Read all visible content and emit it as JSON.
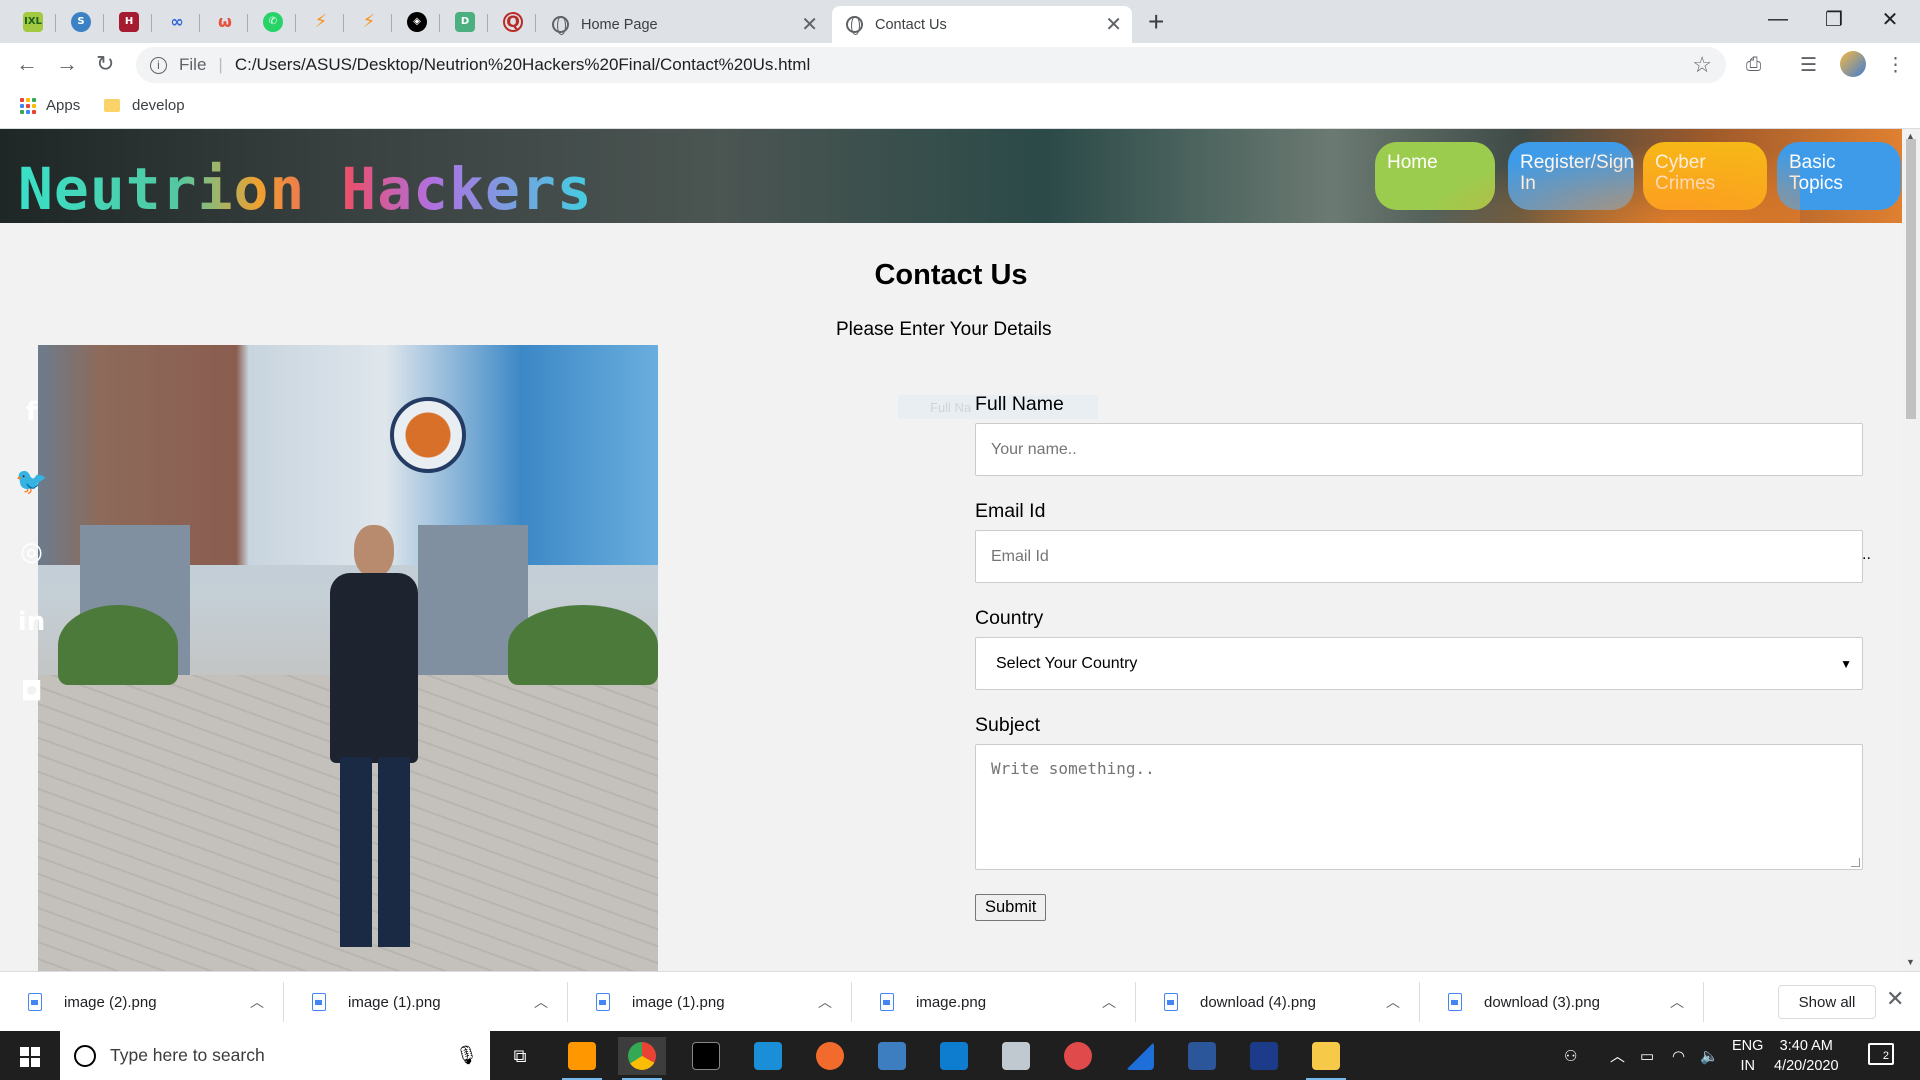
{
  "browser": {
    "tabs": [
      {
        "title": "Home Page",
        "active": false
      },
      {
        "title": "Contact Us",
        "active": true
      }
    ],
    "pinned_favicons": [
      "ixl-icon",
      "simplenote-icon",
      "harvard-icon",
      "infinity-icon",
      "pwa-icon",
      "whatsapp-icon",
      "codeforces-icon",
      "codeforces-icon-2",
      "codepen-icon",
      "dribbble-icon",
      "quora-icon"
    ],
    "address": {
      "scheme": "File",
      "url": "C:/Users/ASUS/Desktop/Neutrion%20Hackers%20Final/Contact%20Us.html"
    },
    "bookmarks": [
      {
        "label": "Apps"
      },
      {
        "label": "develop"
      }
    ]
  },
  "site": {
    "logo": "Neutrion Hackers",
    "nav": [
      {
        "label": "Home",
        "color": "#9ccc4e"
      },
      {
        "label": "Register/Sign In",
        "color": "#3d9be9"
      },
      {
        "label": "Cyber Crimes",
        "color": "#f7b717"
      },
      {
        "label": "Basic Topics",
        "color": "#3d9be9"
      }
    ],
    "social": [
      {
        "icon": "facebook-icon",
        "glyph": "f",
        "color": "#3b5998"
      },
      {
        "icon": "twitter-icon",
        "glyph": "🐦",
        "color": "#1da1f2"
      },
      {
        "icon": "github-icon",
        "glyph": "◎",
        "color": "#d93025"
      },
      {
        "icon": "linkedin-icon",
        "glyph": "in",
        "color": "#0077b5"
      },
      {
        "icon": "instagram-icon",
        "glyph": "◘",
        "color": "#c4161c"
      }
    ]
  },
  "contact": {
    "title": "Contact Us",
    "subtitle": "Please Enter Your Details",
    "ghost_label": "Full Na",
    "fullname_label": "Full Name",
    "fullname_placeholder": "Your name..",
    "email_label": "Email Id",
    "email_placeholder": "Email Id",
    "country_label": "Country",
    "country_selected": "Select Your Country",
    "subject_label": "Subject",
    "subject_placeholder": "Write something..",
    "submit_label": "Submit",
    "stray_dots": ".."
  },
  "downloads": {
    "items": [
      "image (2).png",
      "image (1).png",
      "image (1).png",
      "image.png",
      "download (4).png",
      "download (3).png"
    ],
    "show_all": "Show all"
  },
  "taskbar": {
    "search_placeholder": "Type here to search",
    "language": [
      "ENG",
      "IN"
    ],
    "time": "3:40 AM",
    "date": "4/20/2020",
    "notifications": "2"
  }
}
